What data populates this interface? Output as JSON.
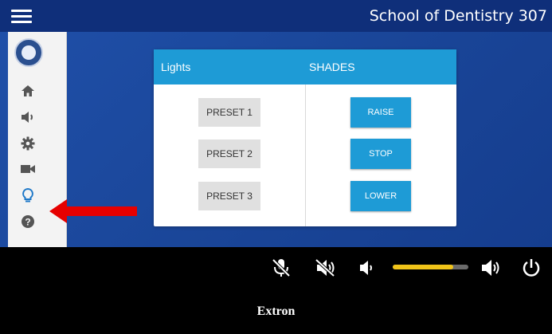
{
  "header": {
    "title": "School of Dentistry 307"
  },
  "sidebar": {
    "items": [
      {
        "name": "home",
        "icon": "home-icon"
      },
      {
        "name": "audio",
        "icon": "speaker-icon"
      },
      {
        "name": "settings",
        "icon": "gear-icon"
      },
      {
        "name": "camera",
        "icon": "video-camera-icon"
      },
      {
        "name": "lights",
        "icon": "lightbulb-icon",
        "selected": true
      },
      {
        "name": "help",
        "icon": "question-icon"
      }
    ]
  },
  "panel": {
    "lights_heading": "Lights",
    "shades_heading": "SHADES",
    "presets": [
      "PRESET 1",
      "PRESET 2",
      "PRESET 3"
    ],
    "shades": [
      "RAISE",
      "STOP",
      "LOWER"
    ]
  },
  "controls": {
    "icons": [
      "mic-mute-icon",
      "speaker-mute-icon",
      "volume-down-icon",
      "volume-up-icon",
      "power-icon"
    ],
    "volume_level": 0.8
  },
  "footer": {
    "brand": "Extron"
  },
  "colors": {
    "header_bg": "#0f2f7a",
    "accent": "#1e9bd6",
    "annotation_arrow": "#e60000",
    "volume_fill": "#f0c419"
  }
}
